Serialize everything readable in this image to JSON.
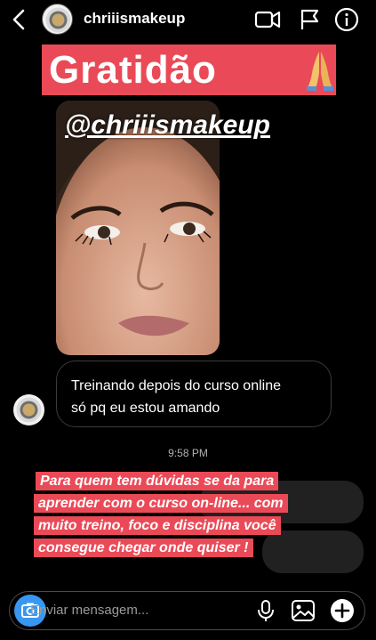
{
  "header": {
    "username": "chriiismakeup"
  },
  "banner": {
    "text": "Gratidão"
  },
  "photo": {
    "overlay_handle": "@chriiismakeup"
  },
  "message": {
    "line1": "Treinando depois do curso online",
    "line2": "só pq eu estou amando"
  },
  "timestamp": "9:58 PM",
  "caption": {
    "lines": [
      "Para quem tem dúvidas se da para",
      "aprender com o curso on-line... com",
      "muito treino, foco e disciplina você",
      "consegue chegar onde quiser !"
    ]
  },
  "composer": {
    "placeholder": "Enviar mensagem..."
  },
  "icons": {
    "back": "chevron-left-icon",
    "video": "video-camera-icon",
    "flag": "flag-icon",
    "info": "info-icon",
    "camera": "camera-icon",
    "mic": "microphone-icon",
    "gallery": "image-icon",
    "add": "plus-circle-icon"
  },
  "colors": {
    "background": "#000000",
    "highlight": "#ea4a57",
    "camera_button": "#3897f0"
  }
}
